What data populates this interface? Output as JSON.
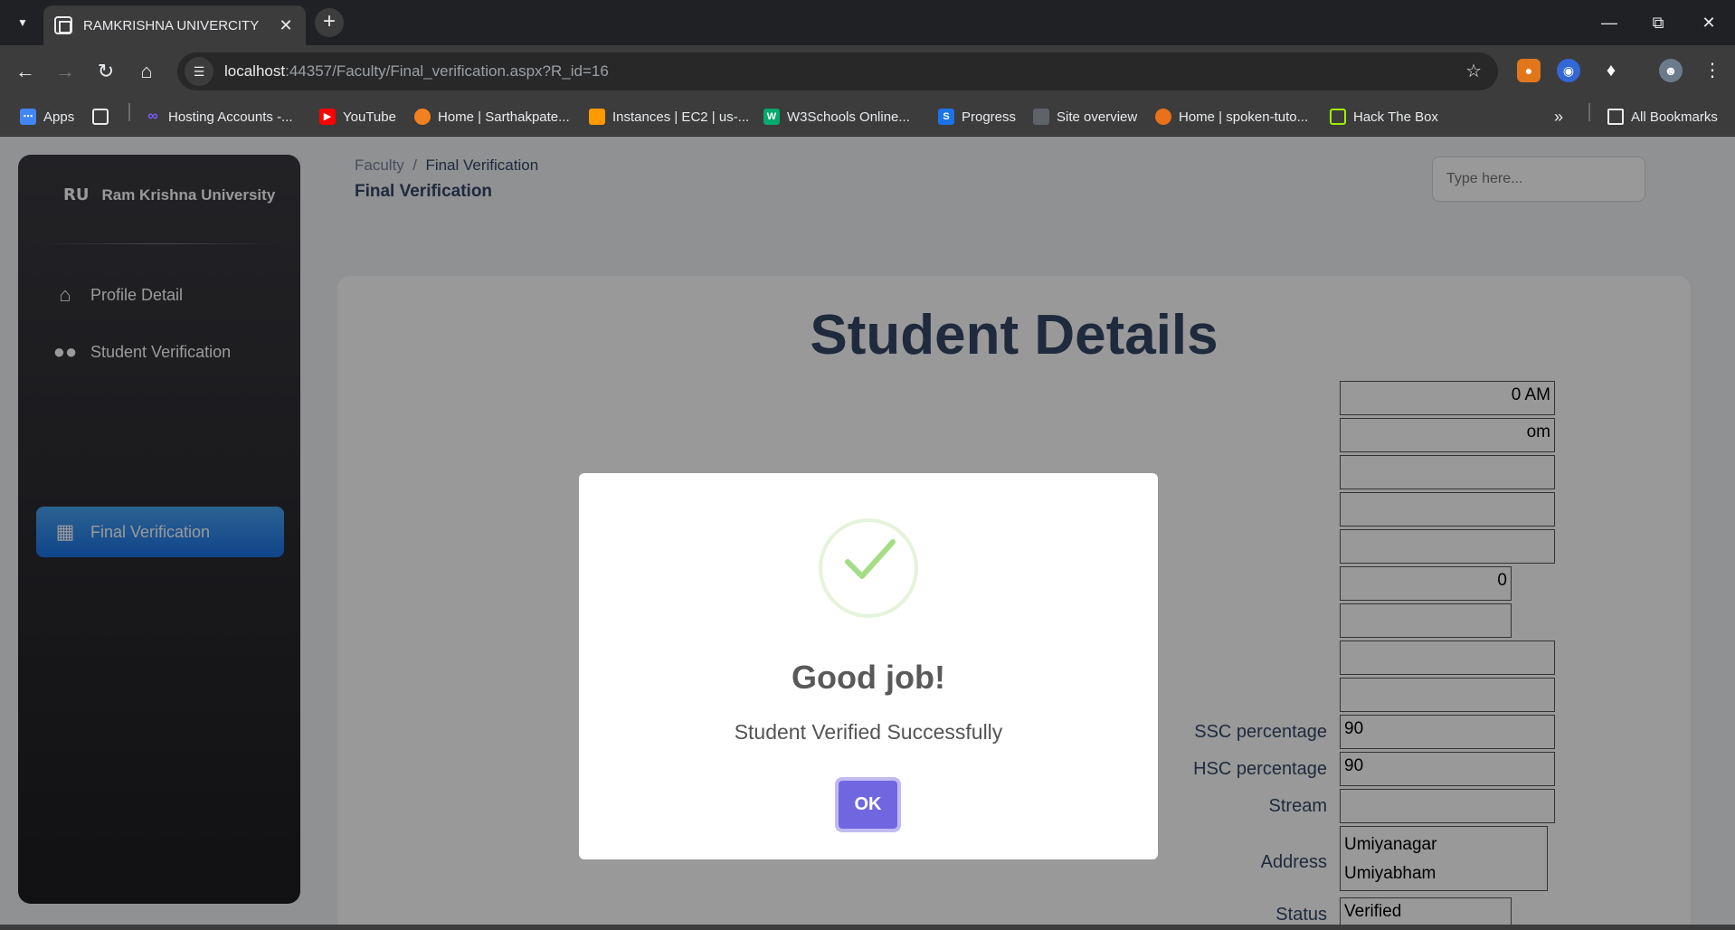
{
  "browser": {
    "tab_title": "RAMKRISHNA UNIVERCITY",
    "url_host": "localhost",
    "url_rest": ":44357/Faculty/Final_verification.aspx?R_id=16",
    "bookmarks": [
      {
        "label": "Apps",
        "icon": "apps-icon",
        "color": "#4285f4"
      },
      {
        "label": "Hosting Accounts -...",
        "icon": "infinity-icon",
        "color": "#7b5cff"
      },
      {
        "label": "YouTube",
        "icon": "youtube-icon",
        "color": "#ff0000"
      },
      {
        "label": "Home | Sarthakpate...",
        "icon": "cloud-icon",
        "color": "#f38020"
      },
      {
        "label": "Instances | EC2 | us-...",
        "icon": "aws-icon",
        "color": "#f90"
      },
      {
        "label": "W3Schools Online...",
        "icon": "w3schools-icon",
        "color": "#04aa6d"
      },
      {
        "label": "Progress",
        "icon": "progress-icon",
        "color": "#1a73e8"
      },
      {
        "label": "Site overview",
        "icon": "site-icon",
        "color": "#5f6368"
      },
      {
        "label": "Home | spoken-tuto...",
        "icon": "spoken-icon",
        "color": "#e8711a"
      },
      {
        "label": "Hack The Box",
        "icon": "htb-icon",
        "color": "#9fef00"
      }
    ],
    "all_bookmarks": "All Bookmarks"
  },
  "sidebar": {
    "logo_text": "RU",
    "brand": "Ram Krishna University",
    "items": [
      {
        "label": "Profile Detail",
        "icon": "home-icon"
      },
      {
        "label": "Student Verification",
        "icon": "users-icon"
      },
      {
        "label": "Final Verification",
        "icon": "building-icon",
        "active": true
      }
    ]
  },
  "header": {
    "breadcrumb_root": "Faculty",
    "breadcrumb_sep": "/",
    "breadcrumb_current": "Final Verification",
    "title": "Final Verification",
    "search_placeholder": "Type here..."
  },
  "card": {
    "title": "Student Details",
    "partial_values": [
      "0 AM",
      "om",
      "0"
    ],
    "fields": [
      {
        "label": "SSC percentage",
        "value": "90"
      },
      {
        "label": "HSC percentage",
        "value": "90"
      },
      {
        "label": "Stream",
        "value": ""
      },
      {
        "label": "Address",
        "value": "Umiyanagar\nUmiyabham"
      },
      {
        "label": "Status",
        "value": "Verified"
      }
    ]
  },
  "modal": {
    "title": "Good job!",
    "text": "Student Verified Successfully",
    "ok_label": "OK"
  },
  "colors": {
    "accent": "#1a73e8",
    "ok_button": "#7066e0",
    "success_check": "#a5dc86"
  }
}
